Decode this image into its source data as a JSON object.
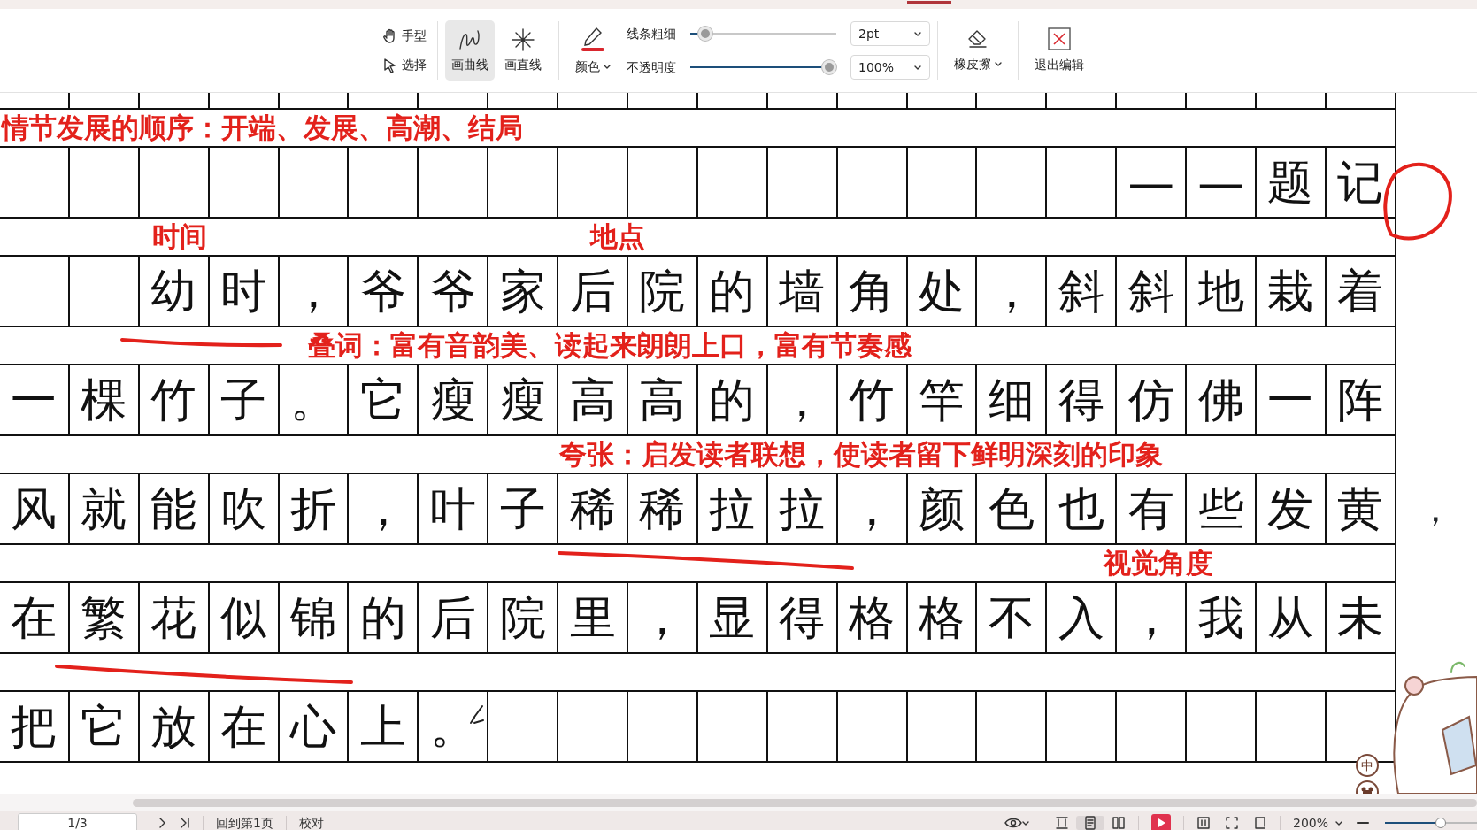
{
  "toolbar": {
    "pointer_tools": [
      {
        "kind": "hand",
        "label": "手型"
      },
      {
        "kind": "select",
        "label": "选择"
      }
    ],
    "draw_tools": [
      {
        "kind": "curve",
        "label": "画曲线",
        "selected": true
      },
      {
        "kind": "line",
        "label": "画直线",
        "selected": false
      }
    ],
    "color": {
      "label": "颜色",
      "color": "#d9272e"
    },
    "line_width": {
      "label": "线条粗细",
      "level": 0.06,
      "value": "2pt"
    },
    "opacity": {
      "label": "不透明度",
      "level": 1,
      "value": "100%"
    },
    "eraser": {
      "label": "橡皮擦"
    },
    "exit": {
      "label": "退出编辑"
    }
  },
  "document": {
    "rows": [
      {
        "notes": [
          "情节发展的顺序：开端、发展、高潮、结局"
        ],
        "cells": [
          null,
          null,
          null,
          null,
          null,
          null,
          null,
          null,
          null,
          null,
          null,
          null,
          null,
          null,
          null,
          null,
          "—",
          "—",
          "题",
          "记"
        ]
      },
      {
        "notes": [
          "时间",
          "地点"
        ],
        "cells": [
          null,
          null,
          "幼",
          "时",
          "，",
          "爷",
          "爷",
          "家",
          "后",
          "院",
          "的",
          "墙",
          "角",
          "处",
          "，",
          "斜",
          "斜",
          "地",
          "栽",
          "着"
        ]
      },
      {
        "notes": [
          "叠词：富有音韵美、读起来朗朗上口，富有节奏感"
        ],
        "cells": [
          "一",
          "棵",
          "竹",
          "子",
          "。",
          "它",
          "瘦",
          "瘦",
          "高",
          "高",
          "的",
          "，",
          "竹",
          "竿",
          "细",
          "得",
          "仿",
          "佛",
          "一",
          "阵"
        ]
      },
      {
        "notes": [
          "夸张：启发读者联想，使读者留下鲜明深刻的印象"
        ],
        "cells": [
          "风",
          "就",
          "能",
          "吹",
          "折",
          "，",
          "叶",
          "子",
          "稀",
          "稀",
          "拉",
          "拉",
          "，",
          "颜",
          "色",
          "也",
          "有",
          "些",
          "发",
          "黄"
        ],
        "outside": "，"
      },
      {
        "notes": [
          "视觉角度"
        ],
        "cells": [
          "在",
          "繁",
          "花",
          "似",
          "锦",
          "的",
          "后",
          "院",
          "里",
          "，",
          "显",
          "得",
          "格",
          "格",
          "不",
          "入",
          "，",
          "我",
          "从",
          "未"
        ]
      },
      {
        "cells": [
          "把",
          "它",
          "放",
          "在",
          "心",
          "上",
          "。",
          null,
          null,
          null,
          null,
          null,
          null,
          null,
          null,
          null,
          null,
          null,
          null,
          null
        ]
      }
    ]
  },
  "ime": {
    "label": "中"
  },
  "status_bar": {
    "page": "1/3",
    "first_page": "回到第1页",
    "proofread": "校对",
    "zoom": {
      "value": "200%",
      "level": 0.62
    }
  }
}
